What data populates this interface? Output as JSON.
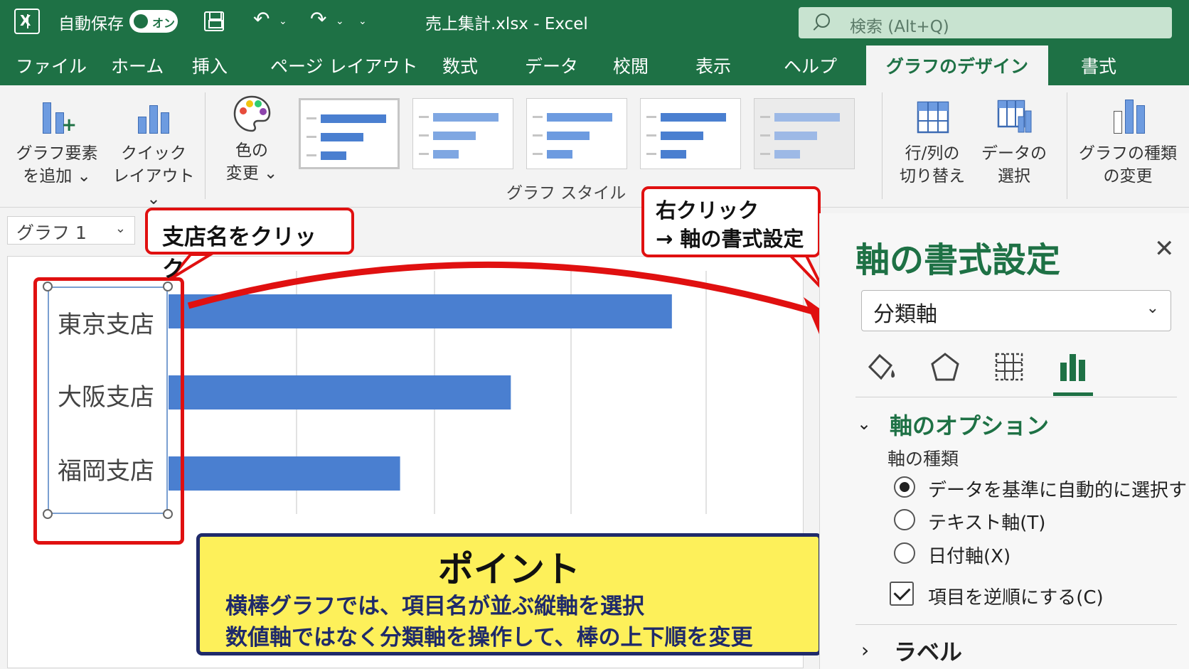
{
  "titlebar": {
    "autosave_label": "自動保存",
    "autosave_state": "オン",
    "document_title": "売上集計.xlsx  -  Excel",
    "search_placeholder": "検索 (Alt+Q)"
  },
  "tabs": [
    "ファイル",
    "ホーム",
    "挿入",
    "ページ レイアウト",
    "数式",
    "データ",
    "校閲",
    "表示",
    "ヘルプ",
    "グラフのデザイン",
    "書式"
  ],
  "active_tab": "グラフのデザイン",
  "ribbon": {
    "add_element": [
      "グラフ要素",
      "を追加 ⌄"
    ],
    "quick_layout": [
      "クイック",
      "レイアウト ⌄"
    ],
    "colors": [
      "色の",
      "変更 ⌄"
    ],
    "style_group_label": "グラフ スタイル",
    "switch_row_col": [
      "行/列の",
      "切り替え"
    ],
    "select_data": [
      "データの",
      "選択"
    ],
    "change_type": [
      "グラフの種類",
      "の変更"
    ]
  },
  "namebox": {
    "value": "グラフ 1",
    "chevron": "⌄"
  },
  "chart_data": {
    "type": "bar",
    "orientation": "horizontal",
    "categories": [
      "東京支店",
      "大阪支店",
      "福岡支店"
    ],
    "values": [
      100,
      68,
      46
    ],
    "xlim": [
      0,
      115
    ],
    "grid": true,
    "bar_color": "#4a7fd0"
  },
  "callouts": {
    "click_branch": "支店名をクリック",
    "right_click_line1": "右クリック",
    "right_click_line2": "→ 軸の書式設定"
  },
  "point": {
    "title": "ポイント",
    "line1": "横棒グラフでは、項目名が並ぶ縦軸を選択",
    "line2": "数値軸ではなく分類軸を操作して、棒の上下順を変更"
  },
  "pane": {
    "title": "軸の書式設定",
    "close": "✕",
    "axis_select": "分類軸",
    "axis_options_title": "軸のオプション",
    "axis_type_label": "軸の種類",
    "radio_auto": "データを基準に自動的に選択する",
    "radio_text": "テキスト軸(T)",
    "radio_date": "日付軸(X)",
    "checkbox_reverse": "項目を逆順にする(C)",
    "labels_section": "ラベル"
  },
  "colors": {
    "excel_green": "#1e7145",
    "highlight_red": "#e01010",
    "point_yellow": "#fdf05a",
    "point_navy": "#1f2a6a"
  }
}
